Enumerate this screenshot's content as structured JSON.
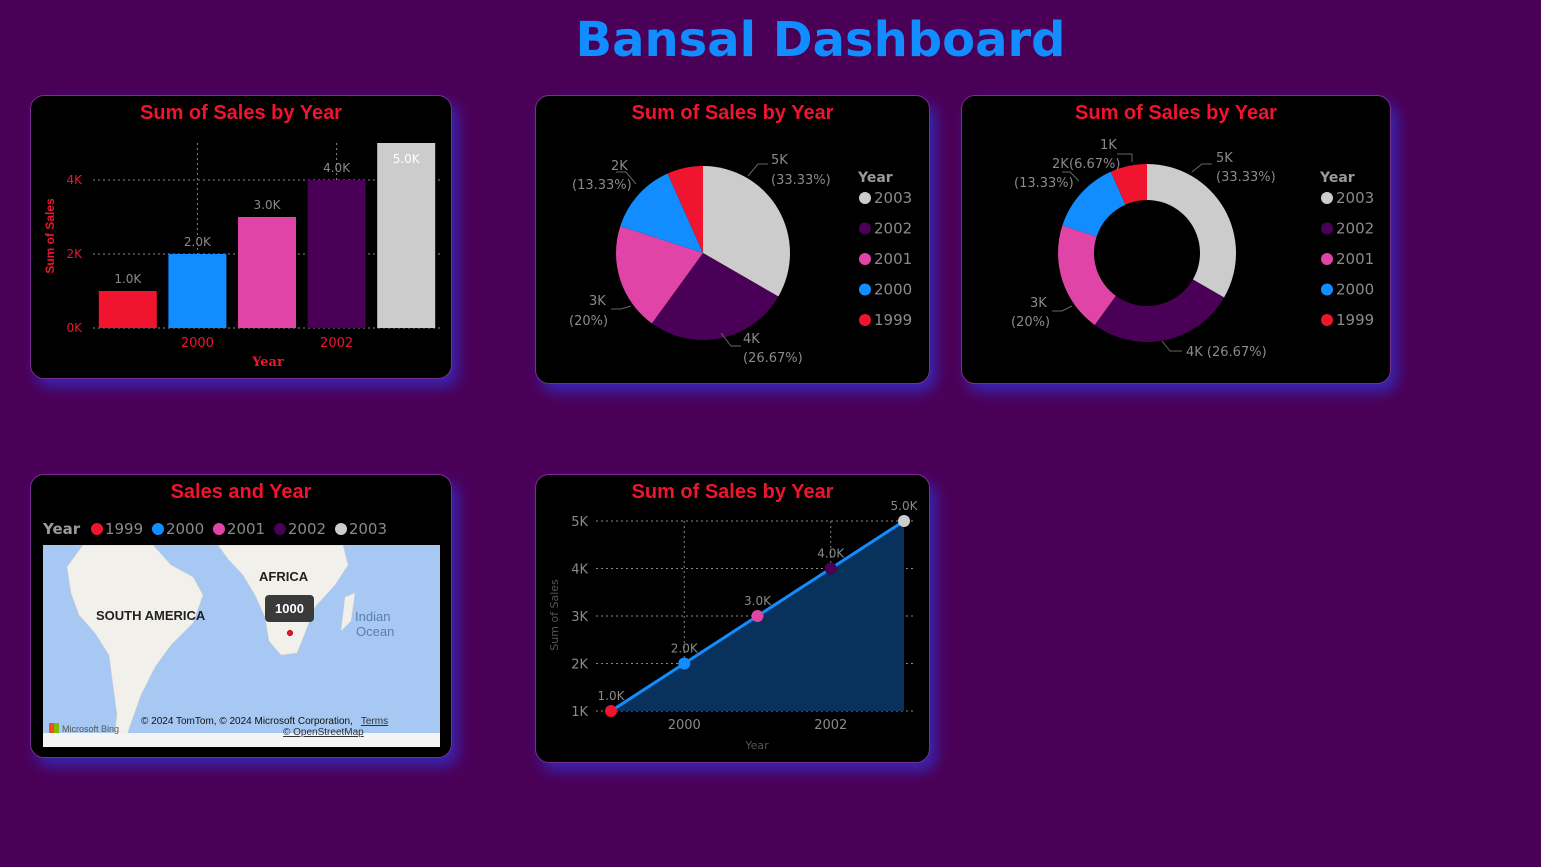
{
  "dashboard": {
    "title": "Bansal Dashboard"
  },
  "colors": {
    "1999": "#f0142e",
    "2000": "#118dff",
    "2001": "#e044a7",
    "2002": "#4b0057",
    "2003": "#cccccc",
    "title": "#118dff",
    "accent": "#f0142e"
  },
  "bar_card": {
    "title": "Sum of Sales by Year",
    "ylabel": "Sum of Sales",
    "xlabel": "Year",
    "y_ticks": [
      "0K",
      "2K",
      "4K"
    ],
    "x_ticks": [
      "2000",
      "2002"
    ],
    "data_labels": [
      "1.0K",
      "2.0K",
      "3.0K",
      "4.0K",
      "5.0K"
    ]
  },
  "pie_card": {
    "title": "Sum of Sales by Year",
    "legend_title": "Year",
    "legend": [
      "2003",
      "2002",
      "2001",
      "2000",
      "1999"
    ],
    "labels": [
      {
        "value": "5K",
        "pct": "(33.33%)"
      },
      {
        "value": "4K",
        "pct": "(26.67%)"
      },
      {
        "value": "3K",
        "pct": "(20%)"
      },
      {
        "value": "2K",
        "pct": "(13.33%)"
      }
    ]
  },
  "donut_card": {
    "title": "Sum of Sales by Year",
    "legend_title": "Year",
    "legend": [
      "2003",
      "2002",
      "2001",
      "2000",
      "1999"
    ],
    "labels": {
      "l5k": "5K",
      "l5kp": "(33.33%)",
      "l4k": "4K (26.67%)",
      "l3k": "3K",
      "l3kp": "(20%)",
      "l2k": "2K",
      "l2kp": "(13.33%)",
      "l1k": "1K",
      "l1kp": "(6.67%)"
    }
  },
  "map_card": {
    "title": "Sales and Year",
    "legend_title": "Year",
    "legend": [
      "1999",
      "2000",
      "2001",
      "2002",
      "2003"
    ],
    "labels": {
      "africa": "AFRICA",
      "south_america": "SOUTH AMERICA",
      "indian": "Indian",
      "ocean": "Ocean"
    },
    "tooltip": "1000",
    "attribution": "© 2024 TomTom, © 2024 Microsoft Corporation,",
    "terms": "Terms",
    "osm": "© OpenStreetMap",
    "bing": "Microsoft Bing"
  },
  "line_card": {
    "title": "Sum of Sales by Year",
    "ylabel": "Sum of Sales",
    "xlabel": "Year",
    "y_ticks": [
      "1K",
      "2K",
      "3K",
      "4K",
      "5K"
    ],
    "x_ticks": [
      "2000",
      "2002"
    ],
    "data_labels": [
      "1.0K",
      "2.0K",
      "3.0K",
      "4.0K",
      "5.0K"
    ]
  },
  "chart_data": [
    {
      "type": "bar",
      "title": "Sum of Sales by Year",
      "categories": [
        "1999",
        "2000",
        "2001",
        "2002",
        "2003"
      ],
      "values": [
        1000,
        2000,
        3000,
        4000,
        5000
      ],
      "xlabel": "Year",
      "ylabel": "Sum of Sales",
      "ylim": [
        0,
        5000
      ]
    },
    {
      "type": "pie",
      "title": "Sum of Sales by Year",
      "categories": [
        "2003",
        "2002",
        "2001",
        "2000",
        "1999"
      ],
      "values": [
        5000,
        4000,
        3000,
        2000,
        1000
      ]
    },
    {
      "type": "pie",
      "title": "Sum of Sales by Year",
      "categories": [
        "2003",
        "2002",
        "2001",
        "2000",
        "1999"
      ],
      "values": [
        5000,
        4000,
        3000,
        2000,
        1000
      ]
    },
    {
      "type": "area",
      "title": "Sum of Sales by Year",
      "x": [
        1999,
        2000,
        2001,
        2002,
        2003
      ],
      "values": [
        1000,
        2000,
        3000,
        4000,
        5000
      ],
      "xlabel": "Year",
      "ylabel": "Sum of Sales",
      "ylim": [
        1000,
        5000
      ]
    }
  ]
}
